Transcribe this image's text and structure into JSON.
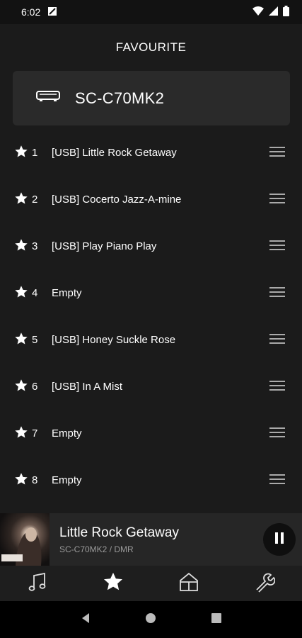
{
  "status_bar": {
    "time": "6:02",
    "icons": [
      "data-saver-icon",
      "wifi-icon",
      "cellular-signal-icon",
      "battery-icon"
    ]
  },
  "header": {
    "title": "FAVOURITE"
  },
  "device": {
    "name": "SC-C70MK2",
    "icon": "stereo-device-icon"
  },
  "favourites": [
    {
      "number": "1",
      "title": "[USB] Little Rock Getaway"
    },
    {
      "number": "2",
      "title": "[USB] Cocerto Jazz-A-mine"
    },
    {
      "number": "3",
      "title": "[USB] Play Piano Play"
    },
    {
      "number": "4",
      "title": "Empty"
    },
    {
      "number": "5",
      "title": "[USB] Honey Suckle Rose"
    },
    {
      "number": "6",
      "title": "[USB] In A Mist"
    },
    {
      "number": "7",
      "title": "Empty"
    },
    {
      "number": "8",
      "title": "Empty"
    }
  ],
  "now_playing": {
    "title": "Little Rock Getaway",
    "subtitle": "SC-C70MK2  / DMR",
    "state": "playing"
  },
  "tabs": [
    {
      "name": "music",
      "icon": "music-note-icon",
      "active": false
    },
    {
      "name": "favourite",
      "icon": "star-icon",
      "active": true
    },
    {
      "name": "home",
      "icon": "home-icon",
      "active": false
    },
    {
      "name": "settings",
      "icon": "wrench-icon",
      "active": false
    }
  ],
  "colors": {
    "background": "#1b1b1b",
    "card": "#2a2a2a",
    "text": "#ffffff",
    "subtext": "#9a9a9a"
  }
}
